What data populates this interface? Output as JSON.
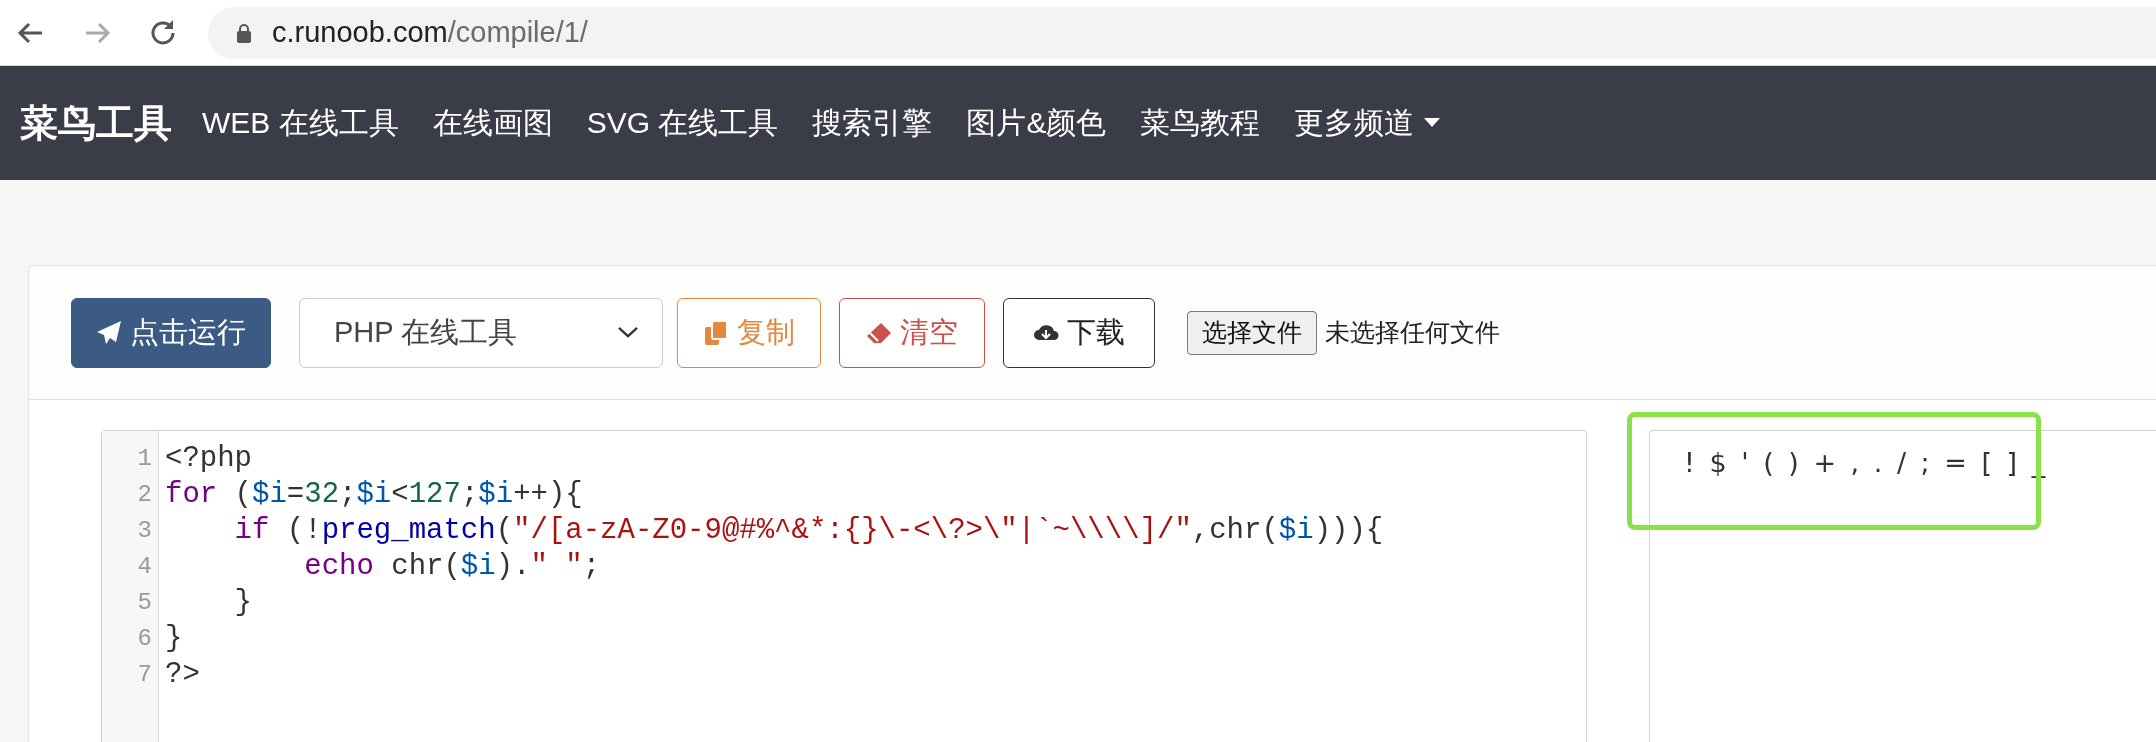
{
  "browser": {
    "url_host": "c.runoob.com",
    "url_path": "/compile/1/"
  },
  "navbar": {
    "brand": "菜鸟工具",
    "items": [
      {
        "label": "WEB 在线工具",
        "dropdown": false
      },
      {
        "label": "在线画图",
        "dropdown": false
      },
      {
        "label": "SVG 在线工具",
        "dropdown": false
      },
      {
        "label": "搜索引擎",
        "dropdown": false
      },
      {
        "label": "图片&颜色",
        "dropdown": false
      },
      {
        "label": "菜鸟教程",
        "dropdown": false
      },
      {
        "label": "更多频道",
        "dropdown": true
      }
    ]
  },
  "toolbar": {
    "run_button": "点击运行",
    "language_select": "PHP 在线工具",
    "copy_button": "复制",
    "clear_button": "清空",
    "download_button": "下载",
    "file_button": "选择文件",
    "file_status": "未选择任何文件"
  },
  "editor": {
    "lines": [
      {
        "number": "1",
        "tokens": [
          {
            "kind": "plain",
            "text": "<?php"
          }
        ]
      },
      {
        "number": "2",
        "tokens": [
          {
            "kind": "keyword",
            "text": "for"
          },
          {
            "kind": "plain",
            "text": " ("
          },
          {
            "kind": "variable",
            "text": "$i"
          },
          {
            "kind": "plain",
            "text": "="
          },
          {
            "kind": "number",
            "text": "32"
          },
          {
            "kind": "plain",
            "text": ";"
          },
          {
            "kind": "variable",
            "text": "$i"
          },
          {
            "kind": "plain",
            "text": "<"
          },
          {
            "kind": "number",
            "text": "127"
          },
          {
            "kind": "plain",
            "text": ";"
          },
          {
            "kind": "variable",
            "text": "$i"
          },
          {
            "kind": "plain",
            "text": "++){"
          }
        ]
      },
      {
        "number": "3",
        "tokens": [
          {
            "kind": "keyword",
            "text": "    if"
          },
          {
            "kind": "plain",
            "text": " (!"
          },
          {
            "kind": "function",
            "text": "preg_match"
          },
          {
            "kind": "plain",
            "text": "("
          },
          {
            "kind": "string",
            "text": "\"/[a-zA-Z0-9@#%^&*:{}\\-<\\?>\\\"|`~\\\\\\\\]/\""
          },
          {
            "kind": "plain",
            "text": ",chr("
          },
          {
            "kind": "variable",
            "text": "$i"
          },
          {
            "kind": "plain",
            "text": "))){"
          }
        ]
      },
      {
        "number": "4",
        "tokens": [
          {
            "kind": "keyword",
            "text": "        echo"
          },
          {
            "kind": "plain",
            "text": " chr("
          },
          {
            "kind": "variable",
            "text": "$i"
          },
          {
            "kind": "plain",
            "text": ")."
          },
          {
            "kind": "string",
            "text": "\" \""
          },
          {
            "kind": "plain",
            "text": ";"
          }
        ]
      },
      {
        "number": "5",
        "tokens": [
          {
            "kind": "plain",
            "text": "    }"
          }
        ]
      },
      {
        "number": "6",
        "tokens": [
          {
            "kind": "plain",
            "text": "}"
          }
        ]
      },
      {
        "number": "7",
        "tokens": [
          {
            "kind": "plain",
            "text": "?>"
          }
        ]
      }
    ]
  },
  "output": {
    "text": "! $ ' ( ) + , . / ; = [ ] _",
    "highlighted": true
  }
}
